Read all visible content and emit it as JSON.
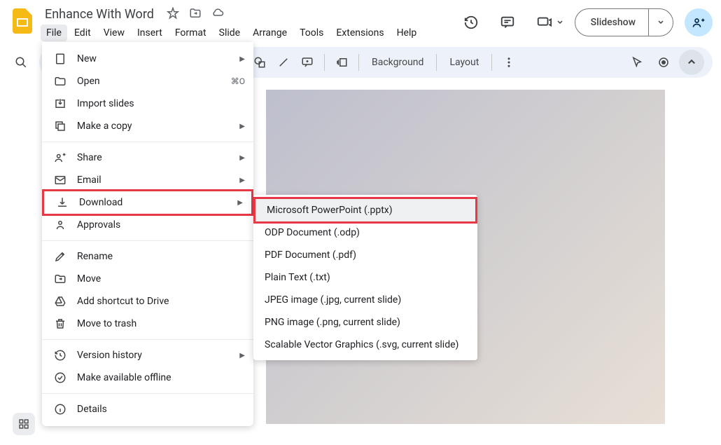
{
  "doc": {
    "title": "Enhance With Word"
  },
  "menubar": [
    "File",
    "Edit",
    "View",
    "Insert",
    "Format",
    "Slide",
    "Arrange",
    "Tools",
    "Extensions",
    "Help"
  ],
  "header": {
    "slideshow": "Slideshow"
  },
  "toolbar": {
    "background": "Background",
    "layout": "Layout"
  },
  "file_menu": {
    "new": "New",
    "open": "Open",
    "open_shortcut": "⌘O",
    "import": "Import slides",
    "copy": "Make a copy",
    "share": "Share",
    "email": "Email",
    "download": "Download",
    "approvals": "Approvals",
    "rename": "Rename",
    "move": "Move",
    "add_shortcut": "Add shortcut to Drive",
    "trash": "Move to trash",
    "version": "Version history",
    "offline": "Make available offline",
    "details": "Details"
  },
  "download_menu": {
    "pptx": "Microsoft PowerPoint (.pptx)",
    "odp": "ODP Document (.odp)",
    "pdf": "PDF Document (.pdf)",
    "txt": "Plain Text (.txt)",
    "jpeg": "JPEG image (.jpg, current slide)",
    "png": "PNG image (.png, current slide)",
    "svg": "Scalable Vector Graphics (.svg, current slide)"
  }
}
